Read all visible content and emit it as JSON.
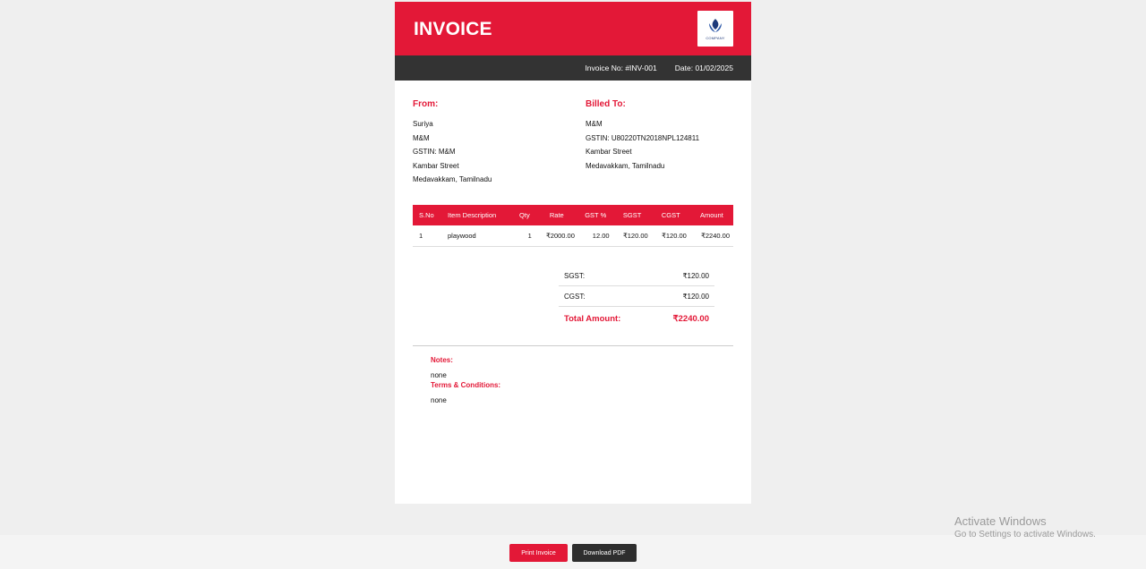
{
  "invoice": {
    "title": "INVOICE",
    "logo_text": "COMPANY",
    "invoice_no": "Invoice No: #INV-001",
    "date": "Date: 01/02/2025",
    "from": {
      "heading": "From:",
      "lines": [
        "Suriya",
        "M&M",
        "GSTIN: M&M",
        "Kambar Street",
        "Medavakkam, Tamilnadu"
      ]
    },
    "to": {
      "heading": "Billed To:",
      "lines": [
        "M&M",
        "GSTIN: U80220TN2018NPL124811",
        "Kambar Street",
        "Medavakkam, Tamilnadu"
      ]
    },
    "table": {
      "headers": [
        "S.No",
        "Item Description",
        "Qty",
        "Rate",
        "GST %",
        "SGST",
        "CGST",
        "Amount"
      ],
      "rows": [
        [
          "1",
          "playwood",
          "1",
          "₹2000.00",
          "12.00",
          "₹120.00",
          "₹120.00",
          "₹2240.00"
        ]
      ]
    },
    "totals": {
      "sgst_label": "SGST:",
      "sgst_value": "₹120.00",
      "cgst_label": "CGST:",
      "cgst_value": "₹120.00",
      "total_label": "Total Amount:",
      "total_value": "₹2240.00"
    },
    "notes": {
      "notes_label": "Notes:",
      "notes_value": "none",
      "terms_label": "Terms & Conditions:",
      "terms_value": "none"
    }
  },
  "actions": {
    "print_label": "Print Invoice",
    "pdf_label": "Download PDF"
  },
  "watermark": {
    "line1": "Activate Windows",
    "line2": "Go to Settings to activate Windows."
  },
  "colors": {
    "accent": "#e31837",
    "dark": "#333333",
    "background": "#efefef"
  }
}
